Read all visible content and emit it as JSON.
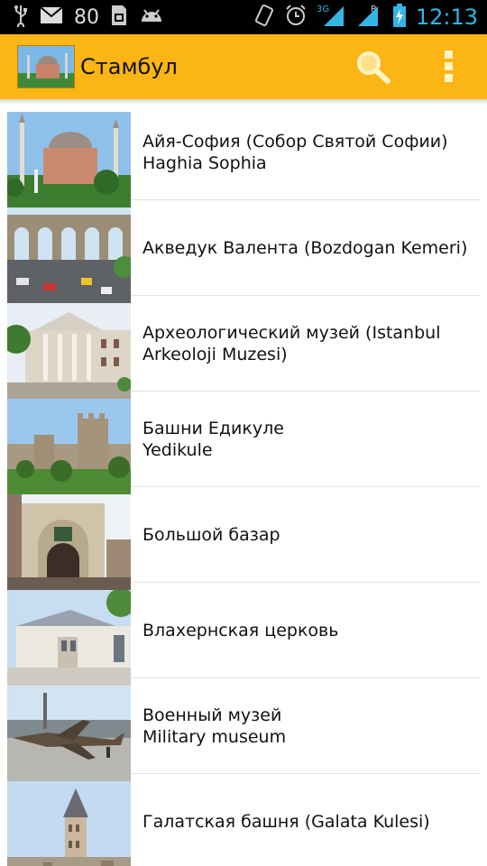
{
  "status_bar": {
    "battery_level": "80",
    "time": "12:13",
    "network_type": "3G",
    "roaming": "R",
    "icons": [
      "usb-icon",
      "mail-icon",
      "sd-card-icon",
      "android-icon",
      "vibrate-icon",
      "alarm-icon",
      "signal-icon",
      "battery-charging-icon"
    ]
  },
  "action_bar": {
    "title": "Стамбул",
    "background": "#fbb515",
    "search_icon": "search-icon",
    "menu_icon": "overflow-menu-icon"
  },
  "places": [
    {
      "line1": "Айя-София (Собор Святой Софии)",
      "line2": "Haghia Sophia",
      "image": "hagia-sophia-photo"
    },
    {
      "line1": "Акведук Валента (Bozdogan Kemeri)",
      "line2": "",
      "image": "aqueduct-photo"
    },
    {
      "line1": "Археологический музей (Istanbul",
      "line2": "Arkeoloji Muzesi)",
      "image": "museum-photo"
    },
    {
      "line1": "Башни Едикуле",
      "line2": "Yedikule",
      "image": "towers-photo"
    },
    {
      "line1": "Большой базар",
      "line2": "",
      "image": "bazaar-photo"
    },
    {
      "line1": "Влахернская церковь",
      "line2": "",
      "image": "church-photo"
    },
    {
      "line1": "Военный музей",
      "line2": "Military museum",
      "image": "military-museum-photo"
    },
    {
      "line1": "Галатская башня (Galata Kulesi)",
      "line2": "",
      "image": "galata-tower-photo"
    }
  ]
}
